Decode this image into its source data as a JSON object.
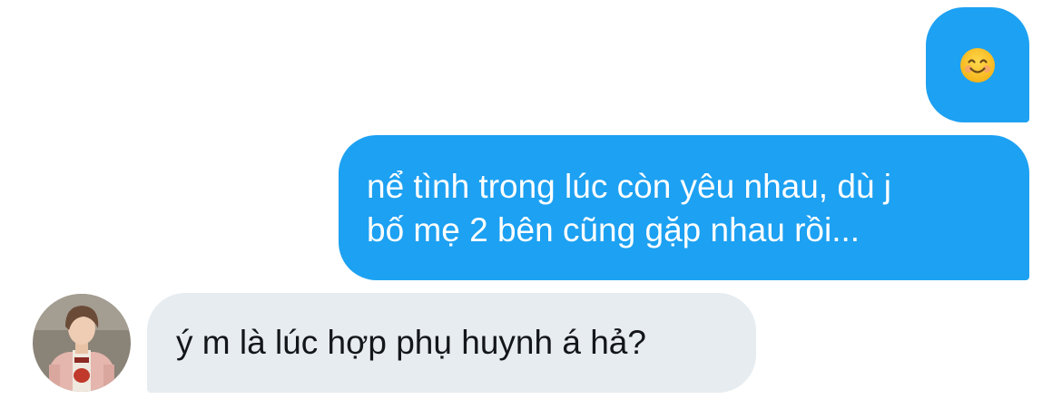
{
  "conversation": {
    "messages": [
      {
        "direction": "outgoing",
        "type": "emoji",
        "emoji": "smiling-face-icon"
      },
      {
        "direction": "outgoing",
        "type": "text",
        "lines": [
          "nể tình trong lúc còn yêu nhau, dù j",
          "bố mẹ 2 bên cũng gặp nhau rồi..."
        ]
      },
      {
        "direction": "incoming",
        "type": "text",
        "text": "ý m là lúc hợp phụ huynh á hả?"
      }
    ]
  },
  "colors": {
    "outgoing_bubble": "#1da1f2",
    "incoming_bubble": "#e6ecf0",
    "incoming_text": "#14171a"
  }
}
